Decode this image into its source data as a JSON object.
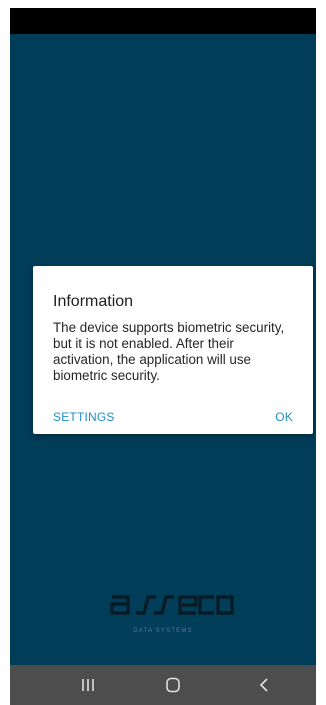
{
  "dialog": {
    "title": "Information",
    "message": "The device supports biometric security, but it is not enabled. After their activation, the application will use biometric security.",
    "settings_label": "SETTINGS",
    "ok_label": "OK"
  },
  "brand": {
    "subtitle": "DATA SYSTEMS"
  },
  "colors": {
    "background": "#003d59",
    "accent": "#1e8fc9",
    "nav_bar": "#4d4d4d"
  },
  "nav": {
    "icons": [
      "recent-apps-icon",
      "home-icon",
      "back-icon"
    ]
  }
}
